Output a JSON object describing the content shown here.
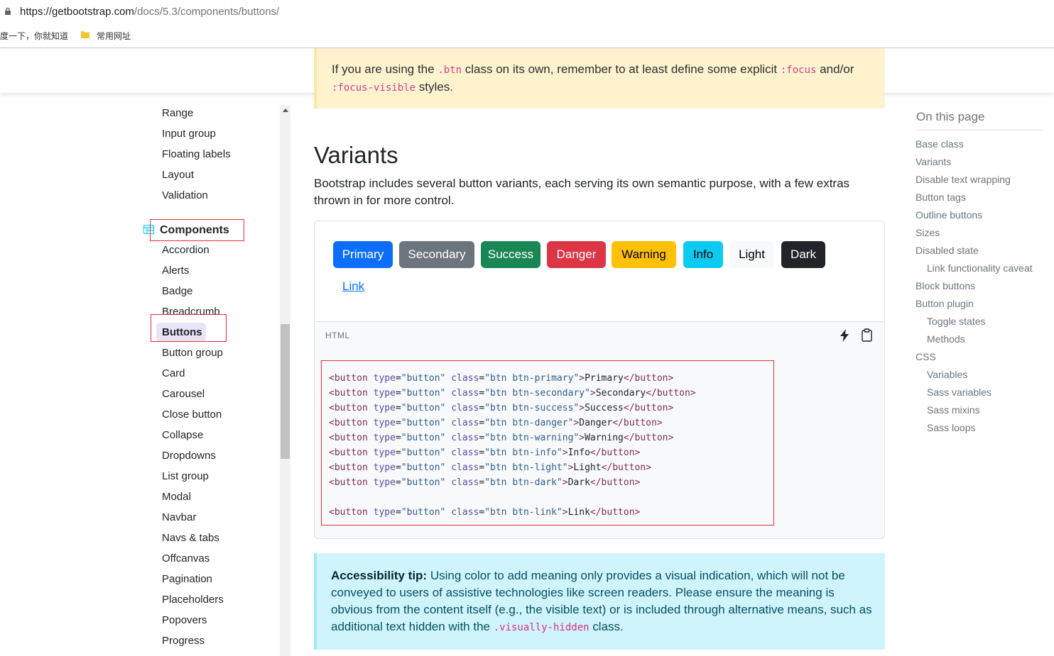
{
  "browser": {
    "url_host": "https://getbootstrap.com",
    "url_path": "/docs/5.3/components/buttons/",
    "bookmarks": [
      "度一下，你就知道",
      "常用网址"
    ]
  },
  "callout_focus": {
    "t1": "If you are using the ",
    "c1": ".btn",
    "t2": " class on its own, remember to at least define some explicit ",
    "c2": ":focus",
    "t3": " and/or ",
    "c3": ":focus-visible",
    "t4": " styles."
  },
  "sidebar": {
    "forms_items": [
      "Range",
      "Input group",
      "Floating labels",
      "Layout",
      "Validation"
    ],
    "components_heading": "Components",
    "components_items": [
      "Accordion",
      "Alerts",
      "Badge",
      "Breadcrumb",
      "Buttons",
      "Button group",
      "Card",
      "Carousel",
      "Close button",
      "Collapse",
      "Dropdowns",
      "List group",
      "Modal",
      "Navbar",
      "Navs & tabs",
      "Offcanvas",
      "Pagination",
      "Placeholders",
      "Popovers",
      "Progress"
    ]
  },
  "main": {
    "title": "Variants",
    "description": "Bootstrap includes several button variants, each serving its own semantic purpose, with a few extras thrown in for more control.",
    "buttons": [
      {
        "label": "Primary",
        "bg": "#0d6efd",
        "fg": "#ffffff"
      },
      {
        "label": "Secondary",
        "bg": "#6c757d",
        "fg": "#ffffff"
      },
      {
        "label": "Success",
        "bg": "#198754",
        "fg": "#ffffff"
      },
      {
        "label": "Danger",
        "bg": "#dc3545",
        "fg": "#ffffff"
      },
      {
        "label": "Warning",
        "bg": "#ffc107",
        "fg": "#000000"
      },
      {
        "label": "Info",
        "bg": "#0dcaf0",
        "fg": "#000000"
      },
      {
        "label": "Light",
        "bg": "#f8f9fa",
        "fg": "#000000"
      },
      {
        "label": "Dark",
        "bg": "#212529",
        "fg": "#ffffff"
      }
    ],
    "link_button": "Link",
    "code_lang": "HTML",
    "code_lines": [
      {
        "cls": "btn btn-primary",
        "text": "Primary"
      },
      {
        "cls": "btn btn-secondary",
        "text": "Secondary"
      },
      {
        "cls": "btn btn-success",
        "text": "Success"
      },
      {
        "cls": "btn btn-danger",
        "text": "Danger"
      },
      {
        "cls": "btn btn-warning",
        "text": "Warning"
      },
      {
        "cls": "btn btn-info",
        "text": "Info"
      },
      {
        "cls": "btn btn-light",
        "text": "Light"
      },
      {
        "cls": "btn btn-dark",
        "text": "Dark"
      },
      {
        "cls": "btn btn-link",
        "text": "Link"
      }
    ],
    "a11y": {
      "label": "Accessibility tip:",
      "text": " Using color to add meaning only provides a visual indication, which will not be conveyed to users of assistive technologies like screen readers. Please ensure the meaning is obvious from the content itself (e.g., the visible text) or is included through alternative means, such as additional text hidden with the ",
      "code": ".visually-hidden",
      "tail": " class."
    }
  },
  "toc": {
    "title": "On this page",
    "items": [
      {
        "label": "Base class",
        "indent": 0
      },
      {
        "label": "Variants",
        "indent": 0
      },
      {
        "label": "Disable text wrapping",
        "indent": 0
      },
      {
        "label": "Button tags",
        "indent": 0
      },
      {
        "label": "Outline buttons",
        "indent": 0
      },
      {
        "label": "Sizes",
        "indent": 0
      },
      {
        "label": "Disabled state",
        "indent": 0
      },
      {
        "label": "Link functionality caveat",
        "indent": 1
      },
      {
        "label": "Block buttons",
        "indent": 0
      },
      {
        "label": "Button plugin",
        "indent": 0
      },
      {
        "label": "Toggle states",
        "indent": 1
      },
      {
        "label": "Methods",
        "indent": 1
      },
      {
        "label": "CSS",
        "indent": 0
      },
      {
        "label": "Variables",
        "indent": 1
      },
      {
        "label": "Sass variables",
        "indent": 1
      },
      {
        "label": "Sass mixins",
        "indent": 1
      },
      {
        "label": "Sass loops",
        "indent": 1
      }
    ]
  }
}
